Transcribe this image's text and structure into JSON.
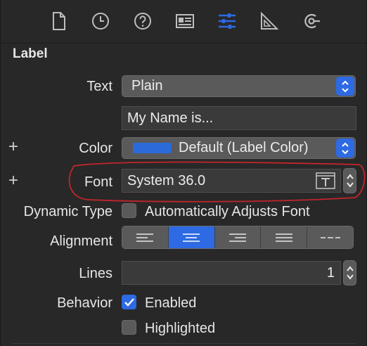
{
  "toolbar": {
    "icons": [
      "file-icon",
      "history-icon",
      "help-icon",
      "identity-icon",
      "attributes-icon",
      "size-icon",
      "connections-icon"
    ],
    "active_color": "#2d6ae3"
  },
  "section": {
    "title": "Label"
  },
  "text": {
    "label": "Text",
    "style_value": "Plain",
    "content_value": "My Name is..."
  },
  "color": {
    "label": "Color",
    "value": "Default (Label Color)",
    "swatch": "#2a6ad9"
  },
  "font": {
    "label": "Font",
    "value": "System 36.0"
  },
  "dynamic_type": {
    "label": "Dynamic Type",
    "checkbox_label": "Automatically Adjusts Font",
    "checked": false
  },
  "alignment": {
    "label": "Alignment",
    "options": [
      "left",
      "center",
      "right",
      "justified",
      "natural"
    ],
    "selected": "center"
  },
  "lines": {
    "label": "Lines",
    "value": "1"
  },
  "behavior": {
    "label": "Behavior",
    "enabled_label": "Enabled",
    "enabled_checked": true,
    "highlighted_label": "Highlighted",
    "highlighted_checked": false
  },
  "annotation_color": "#c0262a"
}
